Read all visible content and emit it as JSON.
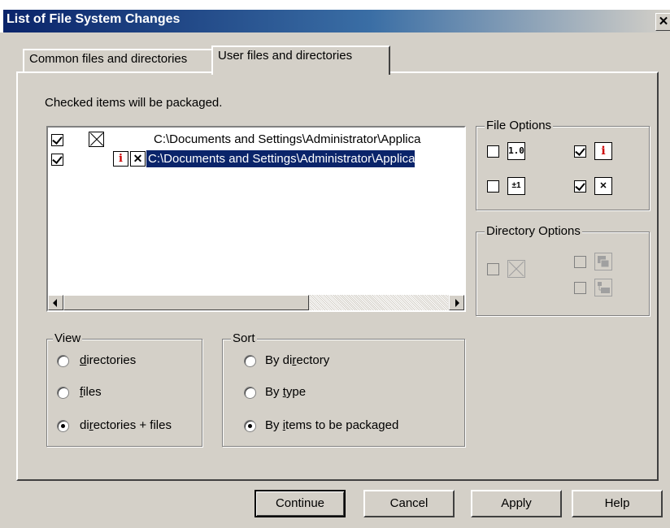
{
  "window": {
    "title": "List of File System Changes",
    "close_glyph": "✕"
  },
  "tabs": [
    {
      "label": "Common files and directories",
      "active": false
    },
    {
      "label": "User files and directories",
      "active": true
    }
  ],
  "instructions": "Checked items will be packaged.",
  "list": {
    "rows": [
      {
        "checked": true,
        "icons": [
          "deleted-x-icon"
        ],
        "path": "C:\\Documents and Settings\\Administrator\\Applica",
        "selected": false
      },
      {
        "checked": true,
        "icons": [
          "info-icon",
          "tool-icon"
        ],
        "path": "C:\\Documents and Settings\\Administrator\\Applica",
        "selected": true
      }
    ]
  },
  "file_options": {
    "legend": "File Options",
    "items": [
      {
        "checked": false,
        "icon": "version-1.0-icon",
        "glyph": "1.0"
      },
      {
        "checked": true,
        "icon": "info-icon",
        "glyph": "i"
      },
      {
        "checked": false,
        "icon": "calendar-icon",
        "glyph": "±1"
      },
      {
        "checked": true,
        "icon": "tool-icon",
        "glyph": "✕"
      }
    ]
  },
  "directory_options": {
    "legend": "Directory Options",
    "items": [
      {
        "checked": false,
        "disabled": true,
        "icon": "deleted-x-icon"
      },
      {
        "checked": false,
        "disabled": true,
        "icon": "folder-stack-icon"
      },
      {
        "checked": false,
        "disabled": true,
        "icon": "folder-tree-icon"
      }
    ]
  },
  "view": {
    "legend": "View",
    "options": [
      {
        "pre": "",
        "key": "d",
        "post": "irectories",
        "selected": false
      },
      {
        "pre": "",
        "key": "f",
        "post": "iles",
        "selected": false
      },
      {
        "pre": "di",
        "key": "r",
        "post": "ectories + files",
        "selected": true
      }
    ]
  },
  "sort": {
    "legend": "Sort",
    "options": [
      {
        "pre": "By di",
        "key": "r",
        "post": "ectory",
        "selected": false
      },
      {
        "pre": "By ",
        "key": "t",
        "post": "ype",
        "selected": false
      },
      {
        "pre": "By ",
        "key": "i",
        "post": "tems to be packaged",
        "selected": true
      }
    ]
  },
  "buttons": {
    "continue": "Continue",
    "cancel": "Cancel",
    "apply": "Apply",
    "help": "Help"
  }
}
